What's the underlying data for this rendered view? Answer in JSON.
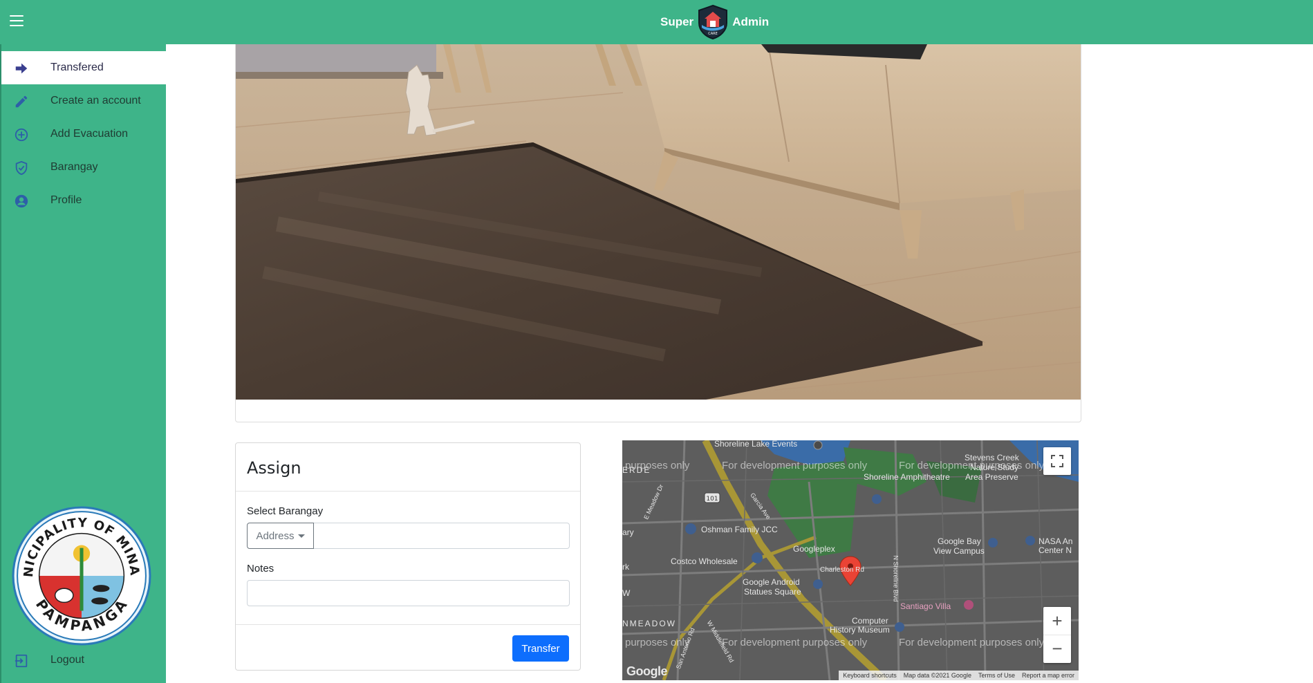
{
  "header": {
    "title_left": "Super",
    "title_right": "Admin",
    "logo_icon": "shield-house-logo-icon",
    "logo_caption": "CARE",
    "menu_icon": "hamburger-menu-icon",
    "color": "#3eb489"
  },
  "sidebar": {
    "items": [
      {
        "label": "Transfered",
        "icon": "arrow-right-icon",
        "active": true
      },
      {
        "label": "Create an account",
        "icon": "pencil-icon",
        "active": false
      },
      {
        "label": "Add Evacuation",
        "icon": "plus-circle-icon",
        "active": false
      },
      {
        "label": "Barangay",
        "icon": "shield-check-icon",
        "active": false
      },
      {
        "label": "Profile",
        "icon": "user-circle-icon",
        "active": false
      }
    ],
    "seal": {
      "top_text": "MUNICIPALITY OF MINALIN",
      "bottom_text": "PAMPANGA"
    },
    "logout_label": "Logout",
    "logout_icon": "logout-icon"
  },
  "assign": {
    "title": "Assign",
    "barangay_label": "Select Barangay",
    "dropdown_label": "Address",
    "address_value": "",
    "notes_label": "Notes",
    "notes_value": "",
    "transfer_label": "Transfer",
    "transfer_color": "#0d6efd"
  },
  "map": {
    "places": [
      "Shoreline Lake Events",
      "Stevens Creek",
      "Nature Study",
      "Area Preserve",
      "Shoreline Amphitheatre",
      "Oshman Family JCC",
      "Googleplex",
      "Google Bay",
      "View Campus",
      "NASA An",
      "Center N",
      "Costco Wholesale",
      "Charleston Rd",
      "Google Android",
      "Statues Square",
      "Santiago Villa",
      "Computer",
      "History Museum",
      "NMEADOW",
      "ERDE",
      "ary",
      "rk",
      "W",
      "E Meadow Dr",
      "Garcia Ave",
      "N Shoreline Blvd",
      "W Middlefield Rd",
      "San Antonio Rd",
      "101"
    ],
    "dev_watermark": "For development purposes only",
    "dev_watermark_short": "purposes only",
    "footer": {
      "shortcuts": "Keyboard shortcuts",
      "map_data": "Map data ©2021 Google",
      "terms": "Terms of Use",
      "report": "Report a map error"
    },
    "logo": "Google",
    "zoom_in": "+",
    "zoom_out": "−"
  }
}
